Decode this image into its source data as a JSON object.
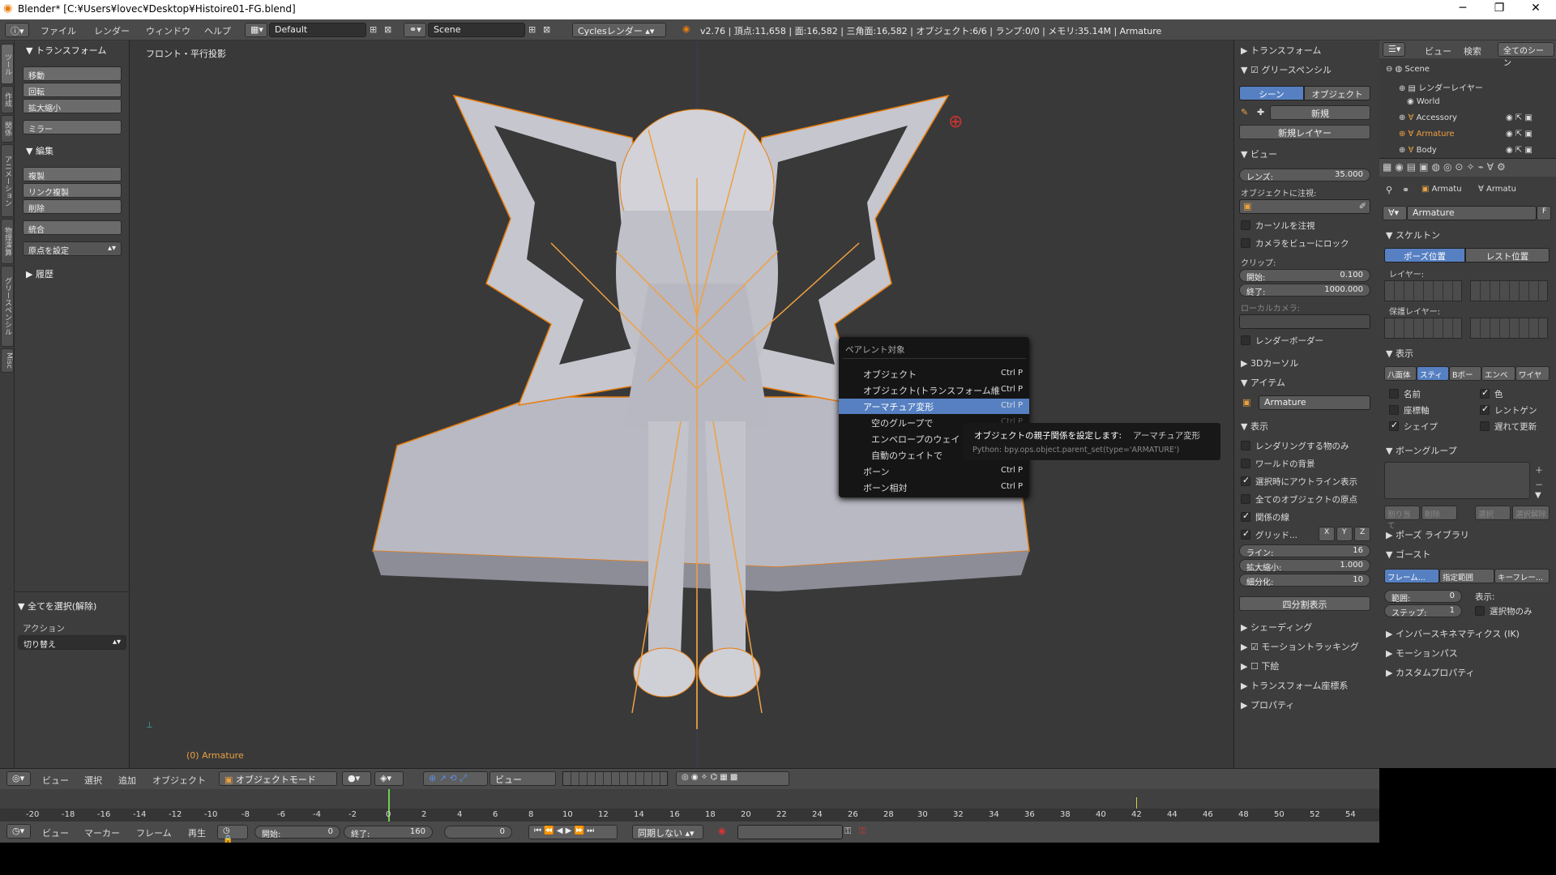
{
  "window": {
    "title": "Blender* [C:¥Users¥lovec¥Desktop¥Histoire01-FG.blend]",
    "min": "─",
    "max": "❐",
    "close": "✕"
  },
  "topbar": {
    "menus": [
      "ファイル",
      "レンダー",
      "ウィンドウ",
      "ヘルプ"
    ],
    "layout": "Default",
    "scene": "Scene",
    "engine": "Cyclesレンダー",
    "stats": "v2.76 | 頂点:11,658 | 面:16,582 | 三角面:16,582 | オブジェクト:6/6 | ランプ:0/0 | メモリ:35.14M | Armature"
  },
  "lefttabs": [
    "ツール",
    "作成",
    "関係",
    "アニメーション",
    "物理演算",
    "グリースペンシル",
    "Misc"
  ],
  "toolshelf": {
    "transform_header": "トランスフォーム",
    "move": "移動",
    "rotate": "回転",
    "scale": "拡大縮小",
    "mirror": "ミラー",
    "edit_header": "編集",
    "duplicate": "複製",
    "link_dup": "リンク複製",
    "delete": "削除",
    "join": "統合",
    "origin": "原点を設定",
    "history": "履歴",
    "select_all": "全てを選択(解除)",
    "action_label": "アクション",
    "action_value": "切り替え"
  },
  "viewport": {
    "view_label": "フロント・平行投影",
    "object_label": "(0) Armature"
  },
  "popup": {
    "title": "ペアレント対象",
    "items": [
      {
        "label": "オブジェクト",
        "key": "Ctrl P"
      },
      {
        "label": "オブジェクト(トランスフォーム維持)",
        "key": "Ctrl P"
      },
      {
        "label": "アーマチュア変形",
        "key": "Ctrl P"
      },
      {
        "label": "空のグループで",
        "key": "Ctrl P"
      },
      {
        "label": "エンベロープのウェイト",
        "key": ""
      },
      {
        "label": "自動のウェイトで",
        "key": ""
      },
      {
        "label": "ボーン",
        "key": "Ctrl P"
      },
      {
        "label": "ボーン相対",
        "key": "Ctrl P"
      }
    ]
  },
  "tooltip": {
    "main": "オブジェクトの親子関係を設定します:",
    "sub": "アーマチュア変形",
    "python": "Python: bpy.ops.object.parent_set(type='ARMATURE')"
  },
  "rightpanel": {
    "transform": "トランスフォーム",
    "grease": "グリースペンシル",
    "scene_tab": "シーン",
    "object_tab": "オブジェクト",
    "new": "新規",
    "new_layer": "新規レイヤー",
    "view": "ビュー",
    "lens_label": "レンズ:",
    "lens_value": "35.000",
    "lock_obj": "オブジェクトに注視:",
    "lock_cursor": "カーソルを注視",
    "lock_cam": "カメラをビューにロック",
    "clip": "クリップ:",
    "clip_start_label": "開始:",
    "clip_start": "0.100",
    "clip_end_label": "終了:",
    "clip_end": "1000.000",
    "local_cam": "ローカルカメラ:",
    "render_border": "レンダーボーダー",
    "cursor3d": "3Dカーソル",
    "item": "アイテム",
    "item_name": "Armature",
    "display": "表示",
    "only_render": "レンダリングする物のみ",
    "world_bg": "ワールドの背景",
    "outline_sel": "選択時にアウトライン表示",
    "all_origins": "全てのオブジェクトの原点",
    "rel_lines": "関係の線",
    "grid": "グリッド...",
    "x": "X",
    "y": "Y",
    "z": "Z",
    "lines_label": "ライン:",
    "lines": "16",
    "gscale_label": "拡大縮小:",
    "gscale": "1.000",
    "subdiv_label": "細分化:",
    "subdiv": "10",
    "quad": "四分割表示",
    "shading": "シェーディング",
    "motion": "モーショントラッキング",
    "bg": "下絵",
    "transform_orient": "トランスフォーム座標系",
    "props": "プロパティ"
  },
  "outliner": {
    "tabs": [
      "ビュー",
      "検索",
      "全てのシーン"
    ],
    "items": [
      "Scene",
      "レンダーレイヤー",
      "World",
      "Accessory",
      "Armature",
      "Body"
    ]
  },
  "props": {
    "breadcrumb1": "Armatu",
    "breadcrumb2": "Armatu",
    "name": "Armature",
    "f": "F",
    "skeleton": "スケルトン",
    "pose_pos": "ポーズ位置",
    "rest_pos": "レスト位置",
    "layers": "レイヤー:",
    "protected": "保護レイヤー:",
    "display": "表示",
    "disp_tabs": [
      "八面体",
      "スティ",
      "Bボー",
      "エンベ",
      "ワイヤ"
    ],
    "names": "名前",
    "colors": "色",
    "axes": "座標軸",
    "xray": "レントゲン",
    "shapes": "シェイプ",
    "delay": "遅れて更新",
    "bone_groups": "ボーングループ",
    "assign": "割り当て",
    "remove": "削除",
    "select": "選択",
    "deselect": "選択解除",
    "pose_lib": "ポーズ ライブラリ",
    "ghost": "ゴースト",
    "ghost_tabs": [
      "フレーム...",
      "指定範囲",
      "キーフレー..."
    ],
    "range_label": "範囲:",
    "range": "0",
    "step_label": "ステップ:",
    "step": "1",
    "disp_label": "表示:",
    "sel_only": "選択物のみ",
    "ik": "インバースキネマティクス (IK)",
    "motion_path": "モーションパス",
    "custom": "カスタムプロパティ"
  },
  "viewhdr": {
    "menus": [
      "ビュー",
      "選択",
      "追加",
      "オブジェクト"
    ],
    "mode": "オブジェクトモード",
    "view": "ビュー"
  },
  "timeline": {
    "ticks": [
      "-20",
      "-18",
      "-16",
      "-14",
      "-12",
      "-10",
      "-8",
      "-6",
      "-4",
      "-2",
      "0",
      "2",
      "4",
      "6",
      "8",
      "10",
      "12",
      "14",
      "16",
      "18",
      "20",
      "22",
      "24",
      "26",
      "28",
      "30",
      "32",
      "34",
      "36",
      "38",
      "40",
      "42",
      "44",
      "46",
      "48",
      "50",
      "52",
      "54"
    ]
  },
  "tlhdr": {
    "menus": [
      "ビュー",
      "マーカー",
      "フレーム",
      "再生"
    ],
    "start_label": "開始:",
    "start": "0",
    "end_label": "終了:",
    "end": "160",
    "current": "0",
    "sync": "同期しない"
  }
}
